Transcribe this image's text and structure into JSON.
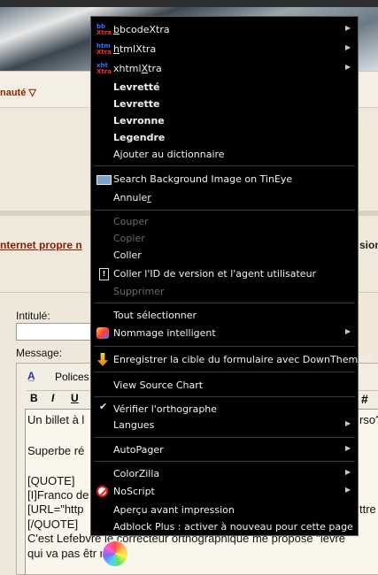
{
  "background": {
    "community_menu": "nauté",
    "topic_link": "nternet propre n",
    "topic_link_tail": "sion",
    "labels": {
      "title_label": "Intitulé:",
      "message_label": "Message:"
    },
    "toolbar": {
      "fonts_label": "Polices",
      "bold": "B",
      "italic": "I",
      "underline": "U",
      "hash": "#"
    },
    "editor_lines": [
      "Un billet à l",
      "",
      "Superbe ré",
      "",
      "[QUOTE]",
      "[I]Franco de",
      "[URL=\"http",
      "[/QUOTE]",
      "C'est Lefebvre le correcteur orthographique me propose \"levre",
      "qui va pas êtr       ntent."
    ],
    "editor_right_fragments": {
      "line1": "rso?",
      "line7": "ttre"
    }
  },
  "context_menu": {
    "items": [
      {
        "label": "bbcodeXtra",
        "accel": "b",
        "icon": "xtra-icon",
        "submenu": true
      },
      {
        "label": "htmlXtra",
        "accel": "h",
        "icon": "xtra-icon",
        "submenu": true
      },
      {
        "label": "xhtmlXtra",
        "accel": "X",
        "icon": "xtra-icon",
        "submenu": true
      },
      {
        "label": "Levretté",
        "bold": true
      },
      {
        "label": "Levrette",
        "bold": true
      },
      {
        "label": "Levronne",
        "bold": true
      },
      {
        "label": "Legendre",
        "bold": true
      },
      {
        "label": "Ajouter au dictionnaire"
      },
      {
        "label": "Search Background Image on TinEye",
        "icon": "tineye-icon"
      },
      {
        "label": "Annuler",
        "accel": "r"
      },
      {
        "label": "Couper",
        "disabled": true
      },
      {
        "label": "Copier",
        "disabled": true
      },
      {
        "label": "Coller"
      },
      {
        "label": "Coller l'ID de version et l'agent utilisateur",
        "icon": "paste-id-icon"
      },
      {
        "label": "Supprimer",
        "disabled": true
      },
      {
        "label": "Tout sélectionner"
      },
      {
        "label": "Nommage intelligent",
        "icon": "smart-naming-icon",
        "submenu": true
      },
      {
        "label": "Enregistrer la cible du formulaire avec DownThemAll!",
        "icon": "downthemall-icon"
      },
      {
        "label": "View Source Chart"
      },
      {
        "label": "Vérifier l'orthographe",
        "checked": true
      },
      {
        "label": "Langues",
        "submenu": true
      },
      {
        "label": "AutoPager",
        "submenu": true
      },
      {
        "label": "ColorZilla",
        "submenu": true
      },
      {
        "label": "NoScript",
        "icon": "noscript-icon",
        "submenu": true
      },
      {
        "label": "Aperçu avant impression"
      },
      {
        "label": "Adblock Plus : activer à nouveau pour cette page"
      }
    ]
  }
}
